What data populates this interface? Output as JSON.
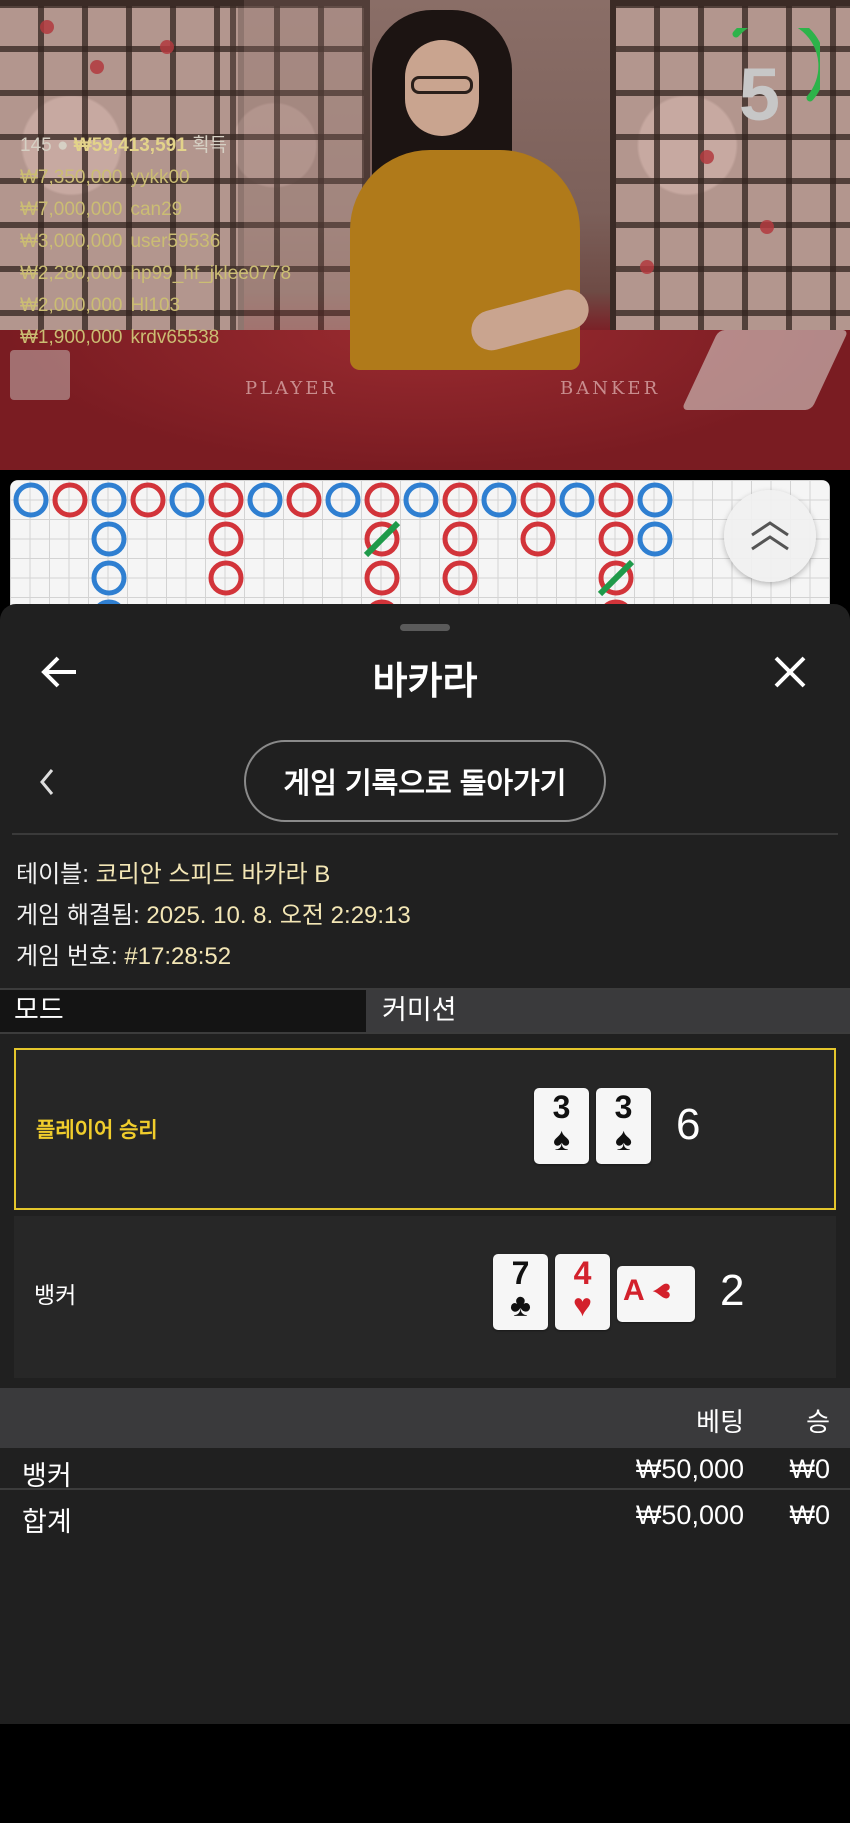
{
  "video": {
    "timer": "5",
    "winners_header": {
      "count": "145",
      "amount": "₩59,413,591",
      "suffix": "획득"
    },
    "winners": [
      {
        "amount": "₩7,350,000",
        "name": "yykk00"
      },
      {
        "amount": "₩7,000,000",
        "name": "can29"
      },
      {
        "amount": "₩3,000,000",
        "name": "user59536"
      },
      {
        "amount": "₩2,280,000",
        "name": "hp99_hf_jklee0778"
      },
      {
        "amount": "₩2,000,000",
        "name": "Hl103"
      },
      {
        "amount": "₩1,900,000",
        "name": "krdv65538"
      }
    ],
    "felt_labels": [
      "PLAYER",
      "BANKER"
    ]
  },
  "roadmap": {
    "colors": {
      "blue": "#2f7fd1",
      "red": "#d2343a",
      "tie": "#1f9a4a"
    },
    "columns": [
      [
        "B"
      ],
      [
        "P"
      ],
      [
        "B",
        "B",
        "B",
        "B"
      ],
      [
        "P"
      ],
      [
        "B"
      ],
      [
        "P",
        "P",
        "P"
      ],
      [
        "B"
      ],
      [
        "P"
      ],
      [
        "B"
      ],
      [
        "P",
        "T",
        "P",
        "P"
      ],
      [
        "B"
      ],
      [
        "P",
        "P",
        "P"
      ],
      [
        "B"
      ],
      [
        "P",
        "P"
      ],
      [
        "B"
      ],
      [
        "P",
        "P",
        "T",
        "P"
      ],
      [
        "B",
        "B"
      ]
    ]
  },
  "sheet": {
    "title": "바카라",
    "history_button": "게임 기록으로 돌아가기",
    "meta": [
      {
        "label": "테이블: ",
        "value": "코리안 스피드 바카라 B"
      },
      {
        "label": "게임 해결됨: ",
        "value": "2025. 10. 8. 오전 2:29:13"
      },
      {
        "label": "게임 번호: ",
        "value": "#17:28:52"
      }
    ],
    "mode": {
      "left": "모드",
      "right": "커미션"
    },
    "player": {
      "label": "플레이어 승리",
      "score": "6",
      "cards": [
        {
          "rank": "3",
          "suit": "♠",
          "color": "black"
        },
        {
          "rank": "3",
          "suit": "♠",
          "color": "black"
        }
      ]
    },
    "banker": {
      "label": "뱅커",
      "score": "2",
      "cards": [
        {
          "rank": "7",
          "suit": "♣",
          "color": "black"
        },
        {
          "rank": "4",
          "suit": "♥",
          "color": "red"
        },
        {
          "rank": "A",
          "suit": "♥",
          "color": "red"
        }
      ]
    },
    "bets": {
      "headers": {
        "bet": "베팅",
        "win": "승"
      },
      "rows": [
        {
          "name": "뱅커",
          "bet": "₩50,000",
          "win": "₩0"
        }
      ],
      "total": {
        "name": "합계",
        "bet": "₩50,000",
        "win": "₩0"
      }
    },
    "accent": "#e4c62c"
  }
}
